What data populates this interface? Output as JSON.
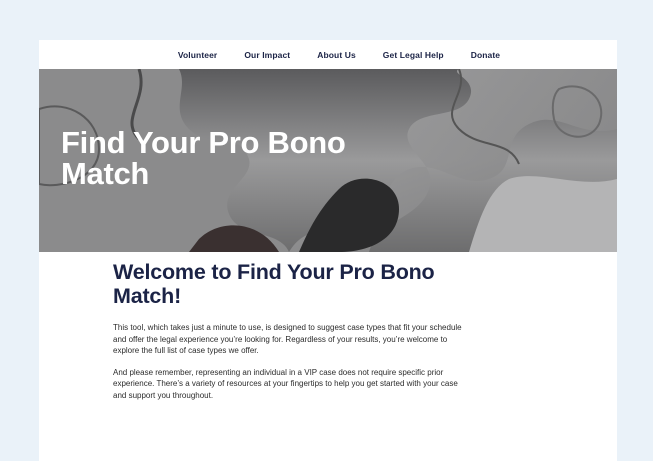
{
  "nav": {
    "items": [
      "Volunteer",
      "Our Impact",
      "About Us",
      "Get Legal Help",
      "Donate"
    ]
  },
  "hero": {
    "title": "Find Your Pro Bono Match"
  },
  "main": {
    "heading": "Welcome to Find Your Pro Bono Match!",
    "paragraphs": [
      "This tool, which takes just a minute to use, is designed to suggest case types that fit your schedule and offer the legal experience you’re looking for. Regardless of your results, you’re welcome to explore the full list of case types we offer.",
      "And please remember, representing an individual in a VIP case does not require specific prior experience. There’s a variety of resources at your fingertips to help you get started with your case and support you throughout."
    ]
  },
  "colors": {
    "page_bg": "#eaf2f9",
    "navy": "#1b2346",
    "hero_text": "#ffffff"
  }
}
